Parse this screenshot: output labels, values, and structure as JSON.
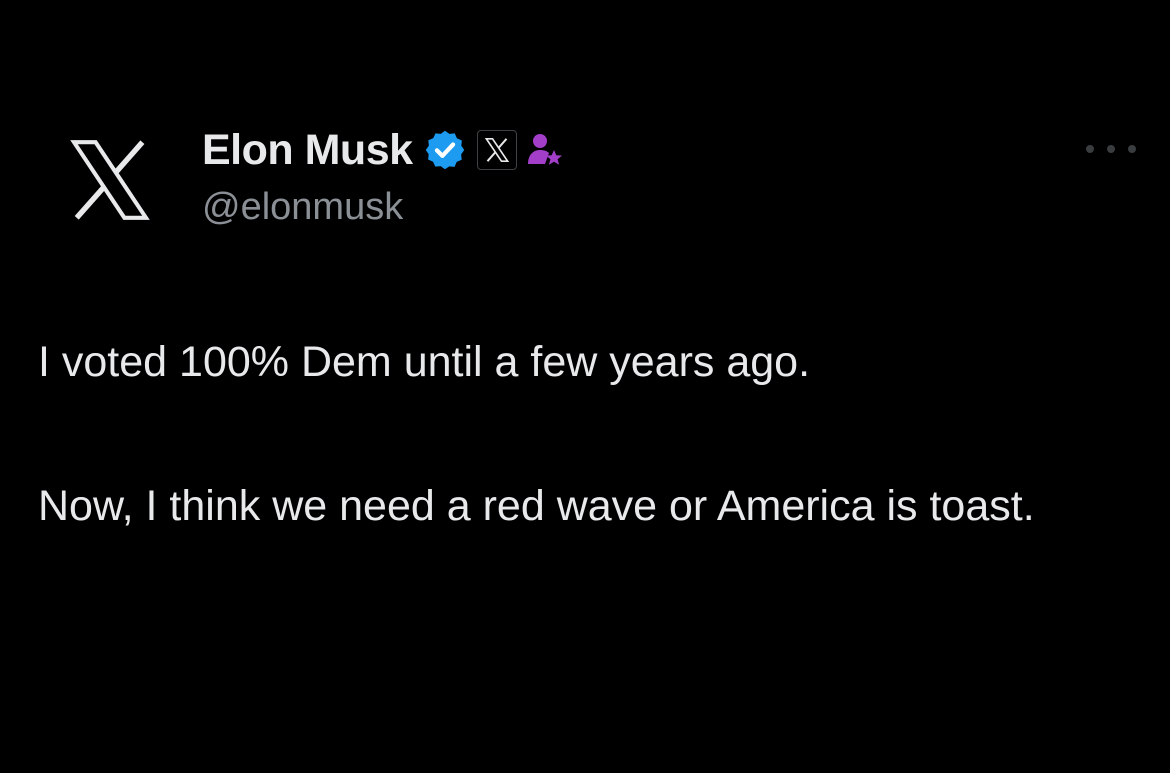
{
  "tweet": {
    "author": {
      "display_name": "Elon Musk",
      "handle": "@elonmusk",
      "avatar_icon": "x-logo-icon",
      "badges": [
        "verified-icon",
        "x-affiliate-badge-icon",
        "government-person-star-icon"
      ]
    },
    "text_paragraphs": [
      "I voted 100% Dem until a few years ago.",
      "Now, I think we need a red wave or America is toast."
    ],
    "more_icon": "more-dots-icon"
  },
  "colors": {
    "background": "#000000",
    "text_primary": "#e7e9ea",
    "text_secondary": "#8b9096",
    "verified_blue": "#1d9bf0",
    "gov_badge_purple": "#a23ec8",
    "more_dots": "#3a3d40"
  }
}
